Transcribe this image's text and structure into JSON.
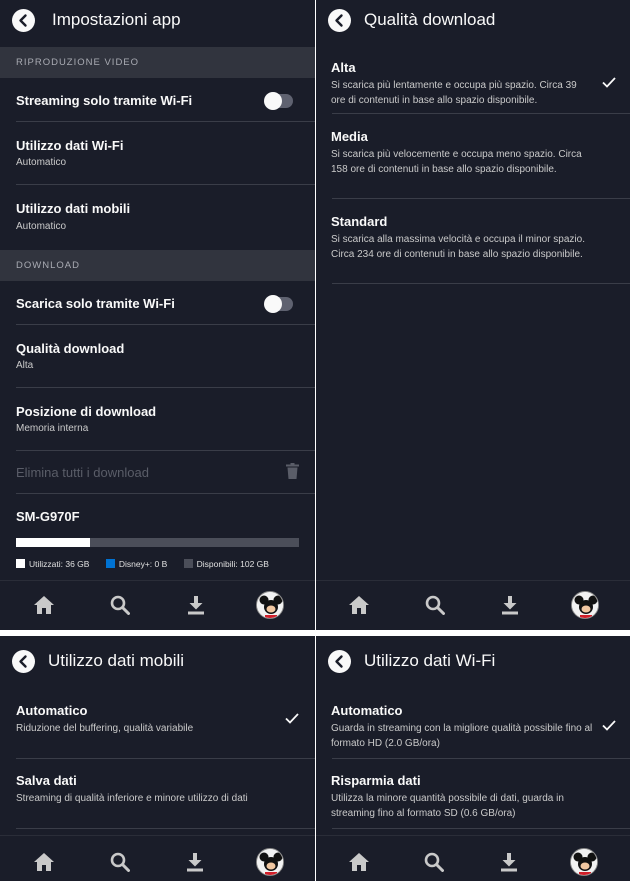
{
  "app_settings": {
    "title": "Impostazioni app",
    "video_section": "RIPRODUZIONE VIDEO",
    "streaming_wifi": "Streaming solo tramite Wi-Fi",
    "wifi_data_title": "Utilizzo dati Wi-Fi",
    "wifi_data_value": "Automatico",
    "mobile_data_title": "Utilizzo dati mobili",
    "mobile_data_value": "Automatico",
    "download_section": "DOWNLOAD",
    "download_wifi": "Scarica solo tramite Wi-Fi",
    "quality_title": "Qualità download",
    "quality_value": "Alta",
    "location_title": "Posizione di download",
    "location_value": "Memoria interna",
    "delete_all": "Elimina tutti i download",
    "device_name": "SM-G970F",
    "storage": {
      "used_label": "Utilizzati: 36 GB",
      "disney_label": "Disney+: 0 B",
      "available_label": "Disponibili: 102 GB",
      "used_gb": 36,
      "disney_gb": 0,
      "available_gb": 102
    }
  },
  "download_quality": {
    "title": "Qualità download",
    "options": [
      {
        "label": "Alta",
        "desc": "Si scarica più lentamente e occupa più spazio. Circa 39 ore di contenuti in base allo spazio disponibile.",
        "selected": true
      },
      {
        "label": "Media",
        "desc": "Si scarica più velocemente e occupa meno spazio. Circa 158 ore di contenuti in base allo spazio disponibile.",
        "selected": false
      },
      {
        "label": "Standard",
        "desc": "Si scarica alla massima velocità e occupa il minor spazio. Circa 234 ore di contenuti in base allo spazio disponibile.",
        "selected": false
      }
    ]
  },
  "mobile_data": {
    "title": "Utilizzo dati mobili",
    "options": [
      {
        "label": "Automatico",
        "desc": "Riduzione del buffering, qualità variabile",
        "selected": true
      },
      {
        "label": "Salva dati",
        "desc": "Streaming di qualità inferiore e minore utilizzo di dati",
        "selected": false
      }
    ]
  },
  "wifi_data": {
    "title": "Utilizzo dati Wi-Fi",
    "options": [
      {
        "label": "Automatico",
        "desc": "Guarda in streaming con la migliore qualità possibile fino al formato HD (2.0 GB/ora)",
        "selected": true
      },
      {
        "label": "Risparmia dati",
        "desc": "Utilizza la minore quantità possibile di dati, guarda in streaming fino al formato SD (0.6 GB/ora)",
        "selected": false
      }
    ]
  },
  "icons": [
    "back-arrow-icon",
    "home-icon",
    "search-icon",
    "download-icon",
    "trash-icon",
    "check-icon",
    "mickey-avatar"
  ],
  "colors": {
    "background": "#1a1d29",
    "section_header": "#31343e",
    "disney_blue": "#0072d2",
    "text": "#f9f9f9"
  }
}
